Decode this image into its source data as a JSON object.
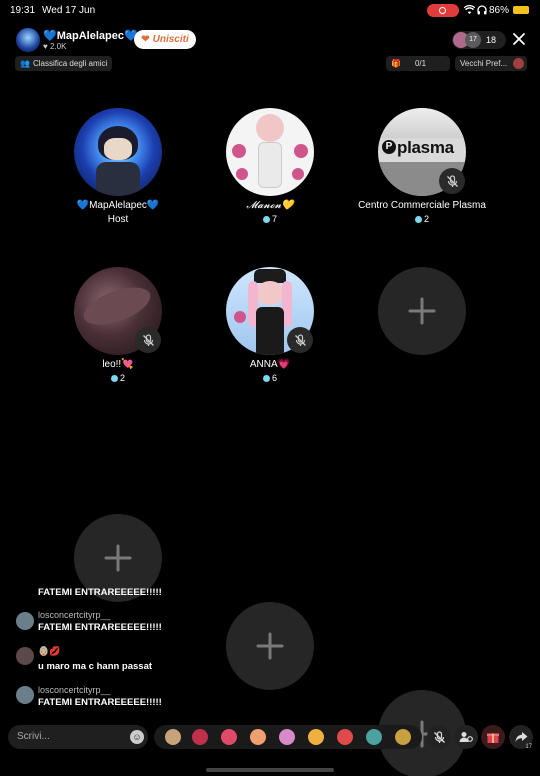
{
  "status": {
    "time": "19:31",
    "date": "Wed 17 Jun",
    "battery": "86%"
  },
  "room": {
    "host_name": "💙MapAlelapec💙",
    "likes": "2.0K",
    "join_label": "Unisciti",
    "leaderboard_label": "Classifica degli amici",
    "viewer_count": "18",
    "viewer_badge": "17",
    "counter": "0/1",
    "old_pref_label": "Vecchi Pref..."
  },
  "seats": [
    {
      "name": "💙MapAlelapec💙",
      "sub": "Host"
    },
    {
      "name": "𝓜𝓪𝓷𝓸𝓷💛",
      "sub": "7"
    },
    {
      "name": "Centro Commerciale Plasma",
      "sub": "2",
      "logo_text": "plasma"
    },
    {
      "name": "leo!!💘",
      "sub": "2"
    },
    {
      "name": "ANNA💗",
      "sub": "6"
    }
  ],
  "chat": [
    {
      "user": "",
      "msg": "FATEMI ENTRAREEEEE!!!!!"
    },
    {
      "user": "losconcertcityrp__",
      "msg": "FATEMI ENTRAREEEEE!!!!!"
    },
    {
      "user": "👵🏼💋",
      "msg": "u maro ma c hann passat"
    },
    {
      "user": "losconcertcityrp__",
      "msg": "FATEMI ENTRAREEEEE!!!!!"
    }
  ],
  "composer": {
    "placeholder": "Scrivi...",
    "share_count": "17"
  },
  "colors": {
    "accent": "#e0703a",
    "recording": "#e23b3b",
    "battery": "#f3c21b",
    "gem": "#7fd7f0"
  },
  "icons": [
    "wifi-icon",
    "headphones-icon",
    "close-icon",
    "plus-icon",
    "mic-off-icon",
    "share-icon",
    "gift-icon"
  ]
}
